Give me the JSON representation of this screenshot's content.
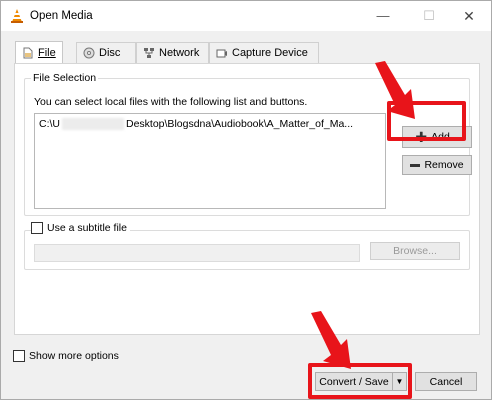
{
  "window": {
    "title": "Open Media",
    "controls": {
      "minimize": "—",
      "maximize": "☐",
      "close": "✕"
    }
  },
  "tabs": [
    {
      "label": "File",
      "icon": "file-icon",
      "active": true
    },
    {
      "label": "Disc",
      "icon": "disc-icon",
      "active": false
    },
    {
      "label": "Network",
      "icon": "network-icon",
      "active": false
    },
    {
      "label": "Capture Device",
      "icon": "capture-device-icon",
      "active": false
    }
  ],
  "file_selection": {
    "legend": "File Selection",
    "info": "You can select local files with the following list and buttons.",
    "list_items": [
      {
        "prefix": "C:\\U",
        "path": "Desktop\\Blogsdna\\Audiobook\\A_Matter_of_Ma..."
      }
    ],
    "add_label": "Add...",
    "remove_label": "Remove"
  },
  "subtitle": {
    "checkbox_label": "Use a subtitle file",
    "checked": false,
    "input_value": "",
    "browse_label": "Browse..."
  },
  "footer": {
    "show_more_label": "Show more options",
    "show_more_checked": false,
    "convert_label": "Convert / Save",
    "cancel_label": "Cancel"
  },
  "colors": {
    "highlight": "#e8141a",
    "window_bg": "#f0f0f0",
    "panel_bg": "#ffffff",
    "button_bg": "#e1e1e1"
  }
}
